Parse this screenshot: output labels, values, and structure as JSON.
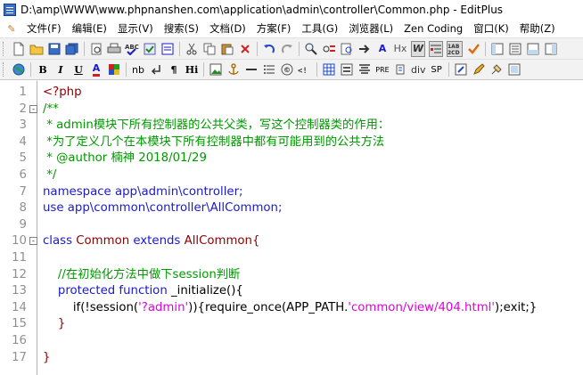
{
  "window": {
    "title": "D:\\amp\\WWW\\www.phpnanshen.com\\application\\admin\\controller\\Common.php - EditPlus"
  },
  "menu": [
    "文件(F)",
    "编辑(E)",
    "显示(V)",
    "搜索(S)",
    "文档(D)",
    "方案(F)",
    "工具(G)",
    "浏览器(L)",
    "Zen Coding",
    "窗口(K)",
    "帮助(Z)"
  ],
  "toolbar1": [
    "A",
    "Hx",
    "W"
  ],
  "toolbar2": [
    "B",
    "I",
    "U",
    "A",
    "nb",
    "¶",
    "Hi",
    "PRE",
    "div",
    "SP"
  ],
  "editor": {
    "lines": [
      {
        "n": "1",
        "fold": "",
        "tokens": [
          {
            "t": "<?php",
            "c": "dark"
          }
        ]
      },
      {
        "n": "2",
        "fold": "-",
        "tokens": [
          {
            "t": "/**",
            "c": "cmt"
          }
        ]
      },
      {
        "n": "3",
        "fold": "",
        "tokens": [
          {
            "t": " * admin模块下所有控制器的公共父类，写这个控制器类的作用：",
            "c": "cmt"
          }
        ]
      },
      {
        "n": "4",
        "fold": "",
        "tokens": [
          {
            "t": " *为了定义几个在本模块下所有控制器中都有可能用到的公共方法",
            "c": "cmt"
          }
        ]
      },
      {
        "n": "5",
        "fold": "",
        "tokens": [
          {
            "t": " * @author 楠神 2018/01/29",
            "c": "cmt"
          }
        ]
      },
      {
        "n": "6",
        "fold": "",
        "tokens": [
          {
            "t": " */",
            "c": "cmt"
          }
        ]
      },
      {
        "n": "7",
        "fold": "",
        "tokens": [
          {
            "t": "namespace",
            "c": "kw"
          },
          {
            "t": " app\\admin\\controller;",
            "c": "kw"
          }
        ]
      },
      {
        "n": "8",
        "fold": "",
        "tokens": [
          {
            "t": "use",
            "c": "kw"
          },
          {
            "t": " app\\common\\controller\\AllCommon;",
            "c": "kw"
          }
        ]
      },
      {
        "n": "9",
        "fold": "",
        "tokens": []
      },
      {
        "n": "10",
        "fold": "-",
        "tokens": [
          {
            "t": "class",
            "c": "kw"
          },
          {
            "t": " Common ",
            "c": "dark"
          },
          {
            "t": "extends",
            "c": "kw"
          },
          {
            "t": " AllCommon{",
            "c": "dark"
          }
        ]
      },
      {
        "n": "11",
        "fold": "",
        "tokens": []
      },
      {
        "n": "12",
        "fold": "",
        "tokens": [
          {
            "t": "    //在初始化方法中做下session判断",
            "c": "cmt"
          }
        ]
      },
      {
        "n": "13",
        "fold": "",
        "tokens": [
          {
            "t": "    protected function",
            "c": "kw"
          },
          {
            "t": " _initialize(){",
            "c": "plain"
          }
        ]
      },
      {
        "n": "14",
        "fold": "",
        "tokens": [
          {
            "t": "        if(!session(",
            "c": "plain"
          },
          {
            "t": "'?admin'",
            "c": "str"
          },
          {
            "t": ")){require_once(APP_PATH.",
            "c": "plain"
          },
          {
            "t": "'common/view/404.html'",
            "c": "str"
          },
          {
            "t": ");exit;}",
            "c": "plain"
          }
        ]
      },
      {
        "n": "15",
        "fold": "",
        "tokens": [
          {
            "t": "    }",
            "c": "dark"
          }
        ]
      },
      {
        "n": "16",
        "fold": "",
        "tokens": []
      },
      {
        "n": "17",
        "fold": "",
        "tokens": [
          {
            "t": "}",
            "c": "dark"
          }
        ]
      }
    ]
  }
}
